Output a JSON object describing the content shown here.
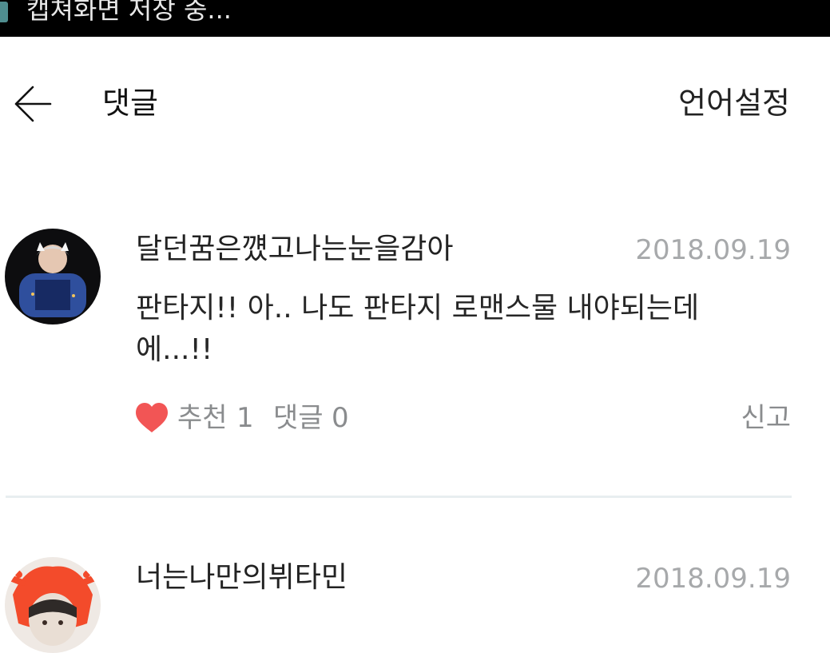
{
  "status_bar": {
    "text": "캡쳐화면 저장 중...",
    "bg_color": "#000000"
  },
  "header": {
    "back_icon": "arrow-left-icon",
    "title": "댓글",
    "language_button": "언어설정"
  },
  "comments": [
    {
      "author": "달던꿈은꺴고나는눈을감아",
      "date": "2018.09.19",
      "text": "판타지!! 아.. 나도 판타지 로맨스물 내야되는데에...!!",
      "like_label": "추천",
      "like_count": "1",
      "reply_label": "댓글",
      "reply_count": "0",
      "report_label": "신고",
      "like_color": "#f25555"
    },
    {
      "author": "너는나만의뷔타민",
      "date": "2018.09.19"
    }
  ]
}
